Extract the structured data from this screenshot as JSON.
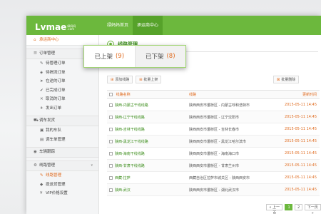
{
  "brand": {
    "logo": "Lvmae",
    "sub_line1": "绿妈妈",
    "sub_line2": ".com"
  },
  "topnav": [
    "绿妈妈首页",
    "承运商中心"
  ],
  "sidebar": {
    "home": "承运商中心",
    "sections": [
      {
        "title": "订单管理",
        "icon": "list-icon",
        "items": [
          "待管理订单",
          "待揭流订单",
          "在途的订单",
          "已完成订单",
          "取消的订单",
          "发出订单"
        ]
      },
      {
        "title": "调车发货",
        "icon": "truck-icon",
        "items": [
          "我的车队",
          "调车单管理"
        ]
      },
      {
        "title": "车辆跟踪",
        "icon": "location-icon",
        "items": []
      },
      {
        "title": "线路管理",
        "icon": "route-icon",
        "items": [
          "线路管理",
          "提送货管理",
          "VIP价格设置"
        ]
      }
    ]
  },
  "page": {
    "title": "线路管理"
  },
  "toolbar": {
    "add": "添加线路",
    "batch_up": "批量上架",
    "batch_delete": "批量删除"
  },
  "tabs": [
    {
      "label": "已上架",
      "count": "(9)"
    },
    {
      "label": "已下架",
      "count": "(8)"
    }
  ],
  "table": {
    "headers": [
      "线路名称",
      "线路",
      "更新时间"
    ],
    "rows": [
      {
        "name": "陕西-内蒙古干线线路",
        "route": "陕西西安市灞桥区 - 内蒙古呼和浩特市",
        "time": "2015-05-11 14:45"
      },
      {
        "name": "陕西-辽宁干线线路",
        "route": "陕西西安市灞桥区 - 辽宁沈阳市",
        "time": "2015-05-11 14:45"
      },
      {
        "name": "陕西-吉林干线线路",
        "route": "陕西西安市灞桥区 - 吉林长春市",
        "time": "2015-05-11 14:45"
      },
      {
        "name": "陕西-黑龙江干线线路",
        "route": "陕西西安市灞桥区 - 黑龙江哈尔滨市",
        "time": "2015-05-11 14:45"
      },
      {
        "name": "陕西-海南干线线路",
        "route": "陕西西安市灞桥区 - 海南海口市",
        "time": "2015-05-11 14:45"
      },
      {
        "name": "陕西-甘肃干线线路",
        "route": "陕西西安市灞桥区 - 甘肃兰州市",
        "time": "2015-05-11 14:45"
      },
      {
        "name": "西藏-拉萨",
        "route": "西藏自治区拉萨市城关区 - 陕西西安市",
        "time": "2015-05-11 14:45"
      },
      {
        "name": "陕西-武汉",
        "route": "陕西西安市灞桥区 - 湖北武汉市",
        "time": "2015-05-11 14:45"
      }
    ]
  },
  "pager": {
    "prev": "« 上一页",
    "p1": "1",
    "p2": "2",
    "next": "下一页 »"
  }
}
